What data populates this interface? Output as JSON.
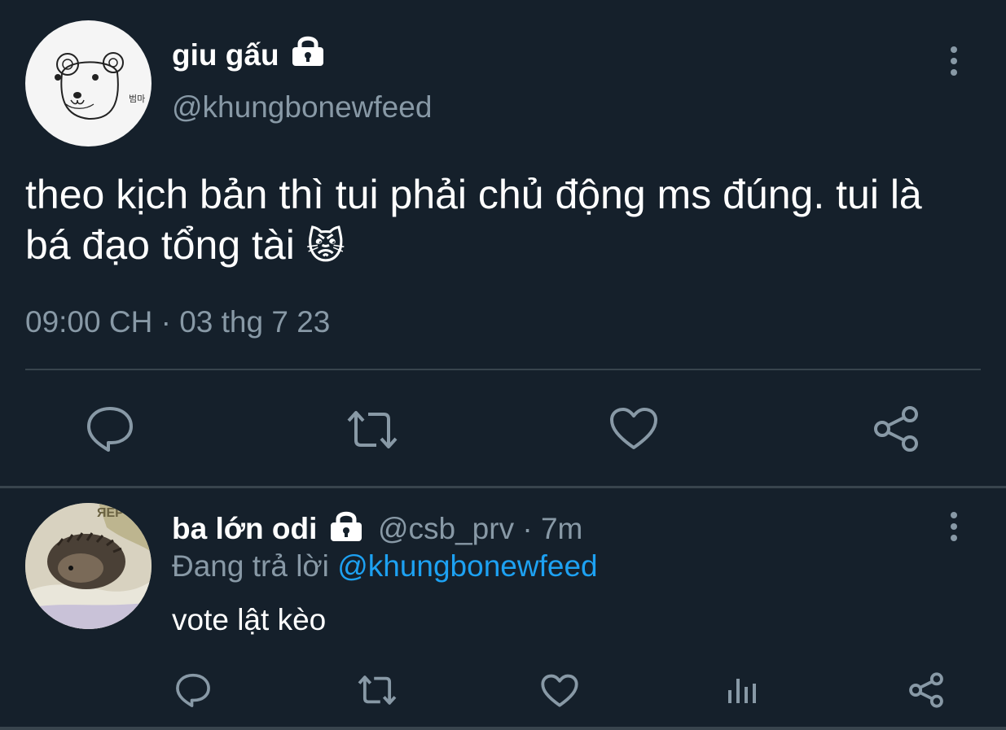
{
  "main_tweet": {
    "author_name": "giu gấu",
    "handle": "@khungbonewfeed",
    "text_line1": "theo kịch bản thì tui phải chủ động ms đúng. tui là",
    "text_line2": "bá đạo tổng tài",
    "emoji": "😾",
    "timestamp": "09:00 CH · 03 thg 7 23",
    "avatar_text": "범마",
    "actions": [
      "reply-icon",
      "retweet-icon",
      "like-icon",
      "share-icon"
    ]
  },
  "reply": {
    "author_name": "ba lớn odi",
    "handle": "@csb_prv",
    "separator": " · ",
    "time": "7m",
    "replying_prefix": "Đang trả lời ",
    "replying_to": "@khungbonewfeed",
    "text": "vote lật kèo",
    "avatar_text": "ЯЕР",
    "actions": [
      "reply-icon",
      "retweet-icon",
      "like-icon",
      "analytics-icon",
      "share-icon"
    ]
  },
  "colors": {
    "background": "#15202b",
    "muted": "#8899a6",
    "link": "#1da1f2",
    "divider": "#38444d"
  }
}
